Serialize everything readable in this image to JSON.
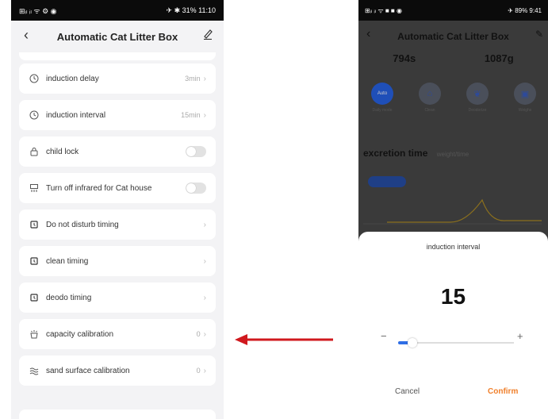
{
  "left": {
    "status": {
      "left": "⊞ᵢₗ ᵢₗ ᯤ ⚙ ◉",
      "right": "✈ ✱ 31% 11:10"
    },
    "header": {
      "title": "Automatic Cat Litter Box",
      "back": "‹"
    },
    "items": [
      {
        "label": "induction delay",
        "value": "3min",
        "icon": "clock-icon"
      },
      {
        "label": "induction interval",
        "value": "15min",
        "icon": "clock-icon"
      },
      {
        "label": "child lock",
        "value": "",
        "icon": "lock-icon"
      },
      {
        "label": "Turn off infrared for Cat house",
        "value": "",
        "icon": "infrared-icon"
      },
      {
        "label": "Do not disturb timing",
        "value": "",
        "icon": "alarm-icon"
      },
      {
        "label": "clean timing",
        "value": "",
        "icon": "alarm-icon"
      },
      {
        "label": "deodo timing",
        "value": "",
        "icon": "alarm-icon"
      },
      {
        "label": "capacity calibration",
        "value": "0",
        "icon": "capacity-icon"
      },
      {
        "label": "sand surface calibration",
        "value": "0",
        "icon": "wave-icon"
      }
    ]
  },
  "right": {
    "status": {
      "left": "⊞ᵢₗ ᵢₗ ᯤ ■ ■ ◉",
      "right": "✈ 89% 9:41"
    },
    "header": {
      "title": "Automatic Cat Litter Box"
    },
    "stats": [
      "794s",
      "1087g"
    ],
    "modes": [
      {
        "label": "Auto",
        "caption": "Daily mode"
      },
      {
        "label": "",
        "caption": "Clean"
      },
      {
        "label": "",
        "caption": "Deodorize"
      },
      {
        "label": "",
        "caption": "Weighs"
      }
    ],
    "excretion": {
      "title": "excretion time",
      "sub": "weight/time"
    },
    "sheet": {
      "title": "induction interval",
      "value": "15",
      "minus": "−",
      "plus": "+",
      "slider_fraction": 0.12,
      "cancel": "Cancel",
      "confirm": "Confirm"
    }
  },
  "colors": {
    "accent": "#2f6ee6",
    "confirm": "#f07f2a",
    "arrow": "#d0191e"
  }
}
